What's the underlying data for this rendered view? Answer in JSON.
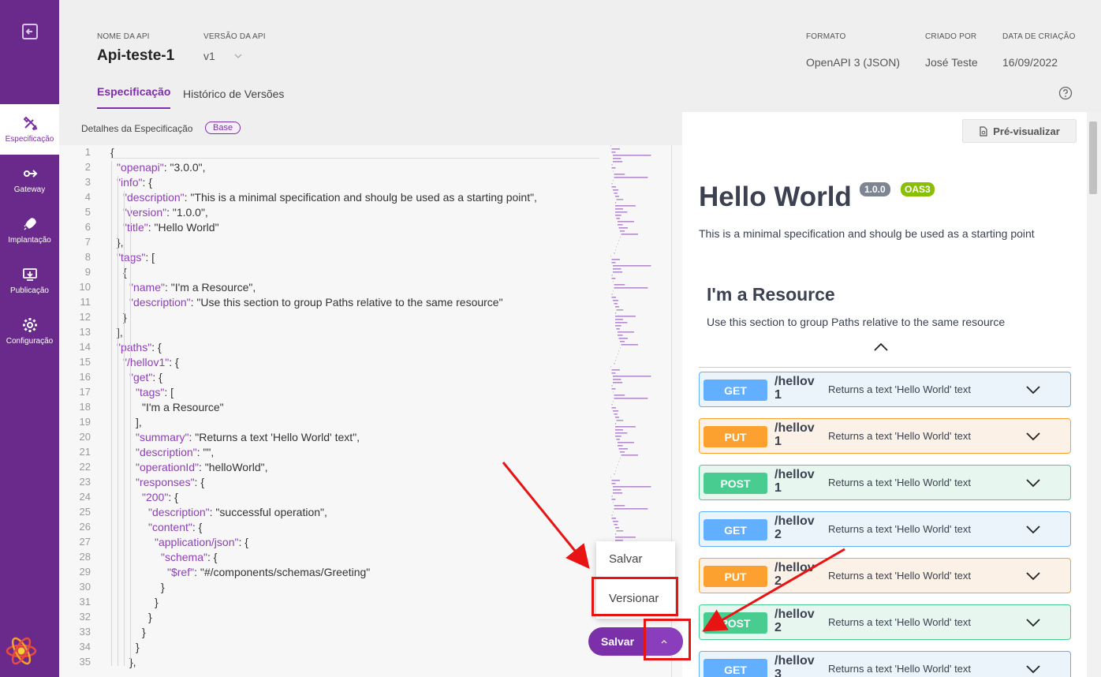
{
  "sidebar": {
    "items": [
      {
        "label": "Especificação",
        "icon": "tools-icon",
        "active": true
      },
      {
        "label": "Gateway",
        "icon": "gateway-icon"
      },
      {
        "label": "Implantação",
        "icon": "rocket-icon"
      },
      {
        "label": "Publicação",
        "icon": "publish-icon"
      },
      {
        "label": "Configuração",
        "icon": "gear-icon"
      }
    ]
  },
  "header": {
    "api_name_label": "NOME DA API",
    "api_name": "Api-teste-1",
    "version_label": "VERSÃO DA API",
    "version": "v1",
    "format_label": "FORMATO",
    "format": "OpenAPI 3 (JSON)",
    "created_by_label": "CRIADO POR",
    "created_by": "José Teste",
    "created_at_label": "DATA DE CRIAÇÃO",
    "created_at": "16/09/2022",
    "tabs": [
      "Especificação",
      "Histórico de Versões"
    ]
  },
  "editor": {
    "title": "Detalhes da Especificação",
    "badge": "Base"
  },
  "code_lines": [
    {
      "n": "1",
      "i": 0,
      "k": "",
      "v": "{"
    },
    {
      "n": "2",
      "i": 1,
      "k": "\"openapi\"",
      "v": ": \"3.0.0\","
    },
    {
      "n": "3",
      "i": 1,
      "k": "\"info\"",
      "v": ": {"
    },
    {
      "n": "4",
      "i": 2,
      "k": "\"description\"",
      "v": ": \"This is a minimal specification and shoulg be used as a starting point\","
    },
    {
      "n": "5",
      "i": 2,
      "k": "\"version\"",
      "v": ": \"1.0.0\","
    },
    {
      "n": "6",
      "i": 2,
      "k": "\"title\"",
      "v": ": \"Hello World\""
    },
    {
      "n": "7",
      "i": 1,
      "k": "",
      "v": "},"
    },
    {
      "n": "8",
      "i": 1,
      "k": "\"tags\"",
      "v": ": ["
    },
    {
      "n": "9",
      "i": 2,
      "k": "",
      "v": "{"
    },
    {
      "n": "10",
      "i": 3,
      "k": "\"name\"",
      "v": ": \"I'm a Resource\","
    },
    {
      "n": "11",
      "i": 3,
      "k": "\"description\"",
      "v": ": \"Use this section to group Paths relative to the same resource\""
    },
    {
      "n": "12",
      "i": 2,
      "k": "",
      "v": "}"
    },
    {
      "n": "13",
      "i": 1,
      "k": "",
      "v": "],"
    },
    {
      "n": "14",
      "i": 1,
      "k": "\"paths\"",
      "v": ": {"
    },
    {
      "n": "15",
      "i": 2,
      "k": "\"/hellov1\"",
      "v": ": {"
    },
    {
      "n": "16",
      "i": 3,
      "k": "\"get\"",
      "v": ": {"
    },
    {
      "n": "17",
      "i": 4,
      "k": "\"tags\"",
      "v": ": ["
    },
    {
      "n": "18",
      "i": 5,
      "k": "",
      "v": "\"I'm a Resource\""
    },
    {
      "n": "19",
      "i": 4,
      "k": "",
      "v": "],"
    },
    {
      "n": "20",
      "i": 4,
      "k": "\"summary\"",
      "v": ": \"Returns a text 'Hello World' text\","
    },
    {
      "n": "21",
      "i": 4,
      "k": "\"description\"",
      "v": ": \"\","
    },
    {
      "n": "22",
      "i": 4,
      "k": "\"operationId\"",
      "v": ": \"helloWorld\","
    },
    {
      "n": "23",
      "i": 4,
      "k": "\"responses\"",
      "v": ": {"
    },
    {
      "n": "24",
      "i": 5,
      "k": "\"200\"",
      "v": ": {"
    },
    {
      "n": "25",
      "i": 6,
      "k": "\"description\"",
      "v": ": \"successful operation\","
    },
    {
      "n": "26",
      "i": 6,
      "k": "\"content\"",
      "v": ": {"
    },
    {
      "n": "27",
      "i": 7,
      "k": "\"application/json\"",
      "v": ": {"
    },
    {
      "n": "28",
      "i": 8,
      "k": "\"schema\"",
      "v": ": {"
    },
    {
      "n": "29",
      "i": 9,
      "k": "\"$ref\"",
      "v": ": \"#/components/schemas/Greeting\""
    },
    {
      "n": "30",
      "i": 8,
      "k": "",
      "v": "}"
    },
    {
      "n": "31",
      "i": 7,
      "k": "",
      "v": "}"
    },
    {
      "n": "32",
      "i": 6,
      "k": "",
      "v": "}"
    },
    {
      "n": "33",
      "i": 5,
      "k": "",
      "v": "}"
    },
    {
      "n": "34",
      "i": 4,
      "k": "",
      "v": "}"
    },
    {
      "n": "35",
      "i": 3,
      "k": "",
      "v": "},"
    }
  ],
  "preview": {
    "button": "Pré-visualizar",
    "title": "Hello World",
    "version_badge": "1.0.0",
    "oas_badge": "OAS3",
    "description": "This is a minimal specification and shoulg be used as a starting point",
    "tag_name": "I'm a Resource",
    "tag_description": "Use this section to group Paths relative to the same resource",
    "operations": [
      {
        "method": "GET",
        "path": "/hellov 1",
        "summary": "Returns a text 'Hello World' text"
      },
      {
        "method": "PUT",
        "path": "/hellov 1",
        "summary": "Returns a text 'Hello World' text"
      },
      {
        "method": "POST",
        "path": "/hellov 1",
        "summary": "Returns a text 'Hello World' text"
      },
      {
        "method": "GET",
        "path": "/hellov 2",
        "summary": "Returns a text 'Hello World' text"
      },
      {
        "method": "PUT",
        "path": "/hellov 2",
        "summary": "Returns a text 'Hello World' text"
      },
      {
        "method": "POST",
        "path": "/hellov 2",
        "summary": "Returns a text 'Hello World' text"
      },
      {
        "method": "GET",
        "path": "/hellov 3",
        "summary": "Returns a text 'Hello World' text"
      }
    ]
  },
  "save_menu": {
    "items": [
      "Salvar",
      "Versionar"
    ],
    "button": "Salvar"
  },
  "colors": {
    "sidebar": "#6a2a8c",
    "accent": "#7b2fa8",
    "annotation": "#e81313"
  }
}
